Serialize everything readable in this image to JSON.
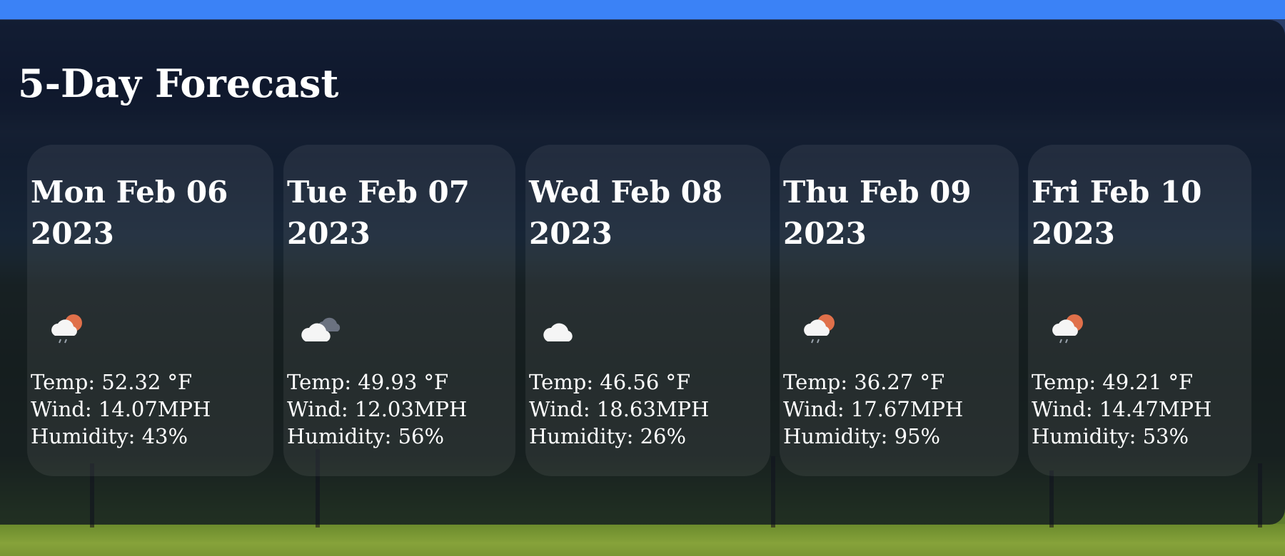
{
  "forecast": {
    "title": "5-Day Forecast",
    "days": [
      {
        "date": "Mon Feb 06 2023",
        "icon": "cloud-sun-rain-icon",
        "temp": "Temp: 52.32 °F",
        "wind": "Wind: 14.07MPH",
        "humidity": "Humidity: 43%"
      },
      {
        "date": "Tue Feb 07 2023",
        "icon": "broken-clouds-icon",
        "temp": "Temp: 49.93 °F",
        "wind": "Wind: 12.03MPH",
        "humidity": "Humidity: 56%"
      },
      {
        "date": "Wed Feb 08 2023",
        "icon": "cloud-icon",
        "temp": "Temp: 46.56 °F",
        "wind": "Wind: 18.63MPH",
        "humidity": "Humidity: 26%"
      },
      {
        "date": "Thu Feb 09 2023",
        "icon": "cloud-sun-rain-icon",
        "temp": "Temp: 36.27 °F",
        "wind": "Wind: 17.67MPH",
        "humidity": "Humidity: 95%"
      },
      {
        "date": "Fri Feb 10 2023",
        "icon": "cloud-sun-rain-icon",
        "temp": "Temp: 49.21 °F",
        "wind": "Wind: 14.47MPH",
        "humidity": "Humidity: 53%"
      }
    ]
  },
  "colors": {
    "accent_bar": "#3b82f6",
    "panel": "#0a101e",
    "text": "#ffffff",
    "sun": "#e0704a",
    "cloud": "#f5f5f5"
  }
}
